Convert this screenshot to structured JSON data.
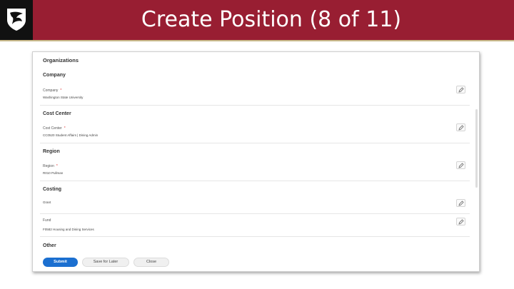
{
  "header": {
    "title": "Create Position (8 of 11)",
    "logo_icon": "cougar-shield-icon",
    "banner_color": "#981e32"
  },
  "form": {
    "title": "Organizations",
    "sections": [
      {
        "heading": "Company",
        "fields": [
          {
            "label": "Company",
            "required": true,
            "value": "Washington State University"
          }
        ]
      },
      {
        "heading": "Cost Center",
        "fields": [
          {
            "label": "Cost Center",
            "required": true,
            "value": "CC0520 Student Affairs | Dining Admin"
          }
        ]
      },
      {
        "heading": "Region",
        "fields": [
          {
            "label": "Region",
            "required": true,
            "value": "R010 Pullman"
          }
        ]
      },
      {
        "heading": "Costing",
        "fields": [
          {
            "label": "",
            "required": false,
            "value": "Grant"
          },
          {
            "label": "Fund",
            "required": false,
            "value": "F0582 Housing and Dining Services"
          }
        ]
      },
      {
        "heading": "Other",
        "fields": []
      }
    ],
    "required_marker": "*",
    "edit_icon": "pencil-icon",
    "buttons": {
      "submit": "Submit",
      "save_for_later": "Save for Later",
      "close": "Close"
    },
    "accent_color": "#1b6fd0"
  }
}
